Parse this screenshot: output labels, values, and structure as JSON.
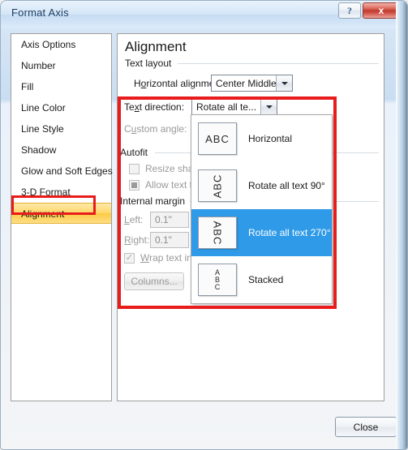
{
  "window": {
    "title": "Format Axis",
    "help_label": "?",
    "close_label": "x"
  },
  "sidebar": {
    "items": [
      {
        "label": "Axis Options",
        "selected": false
      },
      {
        "label": "Number",
        "selected": false
      },
      {
        "label": "Fill",
        "selected": false
      },
      {
        "label": "Line Color",
        "selected": false
      },
      {
        "label": "Line Style",
        "selected": false
      },
      {
        "label": "Shadow",
        "selected": false
      },
      {
        "label": "Glow and Soft Edges",
        "selected": false
      },
      {
        "label": "3-D Format",
        "selected": false
      },
      {
        "label": "Alignment",
        "selected": true
      }
    ]
  },
  "main": {
    "title": "Alignment",
    "sections": {
      "text_layout": "Text layout",
      "autofit": "Autofit",
      "internal_margin": "Internal margin"
    },
    "horizontal_alignment": {
      "label": "Horizontal alignment:",
      "value": "Center Middle"
    },
    "text_direction": {
      "label": "Text direction:",
      "value": "Rotate all te..."
    },
    "custom_angle": {
      "label": "Custom angle:",
      "value": ""
    },
    "autofit": {
      "resize_shape": "Resize shape",
      "allow_text": "Allow text to"
    },
    "margins": {
      "left_label": "Left:",
      "left_value": "0.1\"",
      "right_label": "Right:",
      "right_value": "0.1\"",
      "wrap_label": "Wrap text in"
    },
    "columns_button": "Columns..."
  },
  "dropdown": {
    "items": [
      {
        "icon": "abc-horizontal-icon",
        "glyph": "ABC",
        "label": "Horizontal",
        "selected": false
      },
      {
        "icon": "abc-rotate-90-icon",
        "glyph": "ABC",
        "label": "Rotate all text 90°",
        "selected": false
      },
      {
        "icon": "abc-rotate-270-icon",
        "glyph": "ABC",
        "label": "Rotate all text 270°",
        "selected": true
      },
      {
        "icon": "abc-stacked-icon",
        "glyph": "A\nB\nC",
        "label": "Stacked",
        "selected": false
      }
    ]
  },
  "footer": {
    "close_label": "Close"
  },
  "colors": {
    "selection_blue": "#2f9ae8",
    "annotation_red": "#e81c1c",
    "sidebar_selected": "#fbca44"
  }
}
